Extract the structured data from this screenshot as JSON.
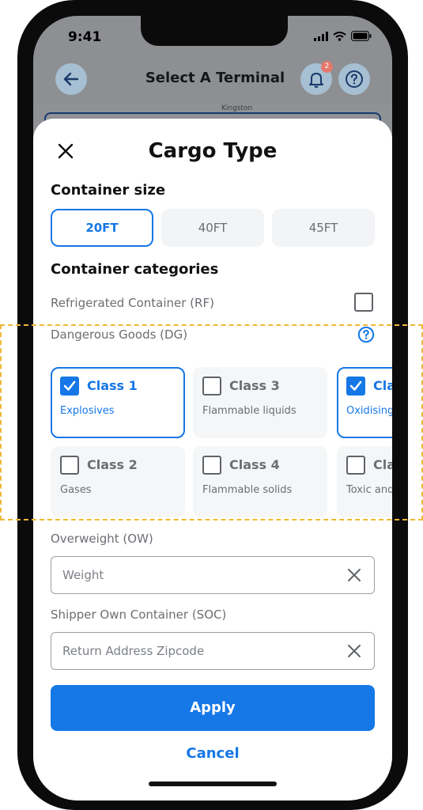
{
  "status_bar": {
    "time": "9:41"
  },
  "header": {
    "title": "Select A Terminal",
    "back_icon": "arrow-left-icon",
    "notification_icon": "bell-icon",
    "notification_count": "2",
    "help_icon": "question-circle-icon"
  },
  "map": {
    "label": "Kingston"
  },
  "sheet": {
    "title": "Cargo Type",
    "close_icon": "close-icon",
    "container_size": {
      "title": "Container size",
      "options": [
        "20FT",
        "40FT",
        "45FT"
      ],
      "selected": "20FT"
    },
    "categories": {
      "title": "Container categories",
      "refrigerated": {
        "label": "Refrigerated Container (RF)",
        "checked": false
      },
      "dangerous_goods": {
        "label": "Dangerous Goods (DG)",
        "help_icon": "question-circle-icon",
        "classes": [
          {
            "name": "Class 1",
            "desc": "Explosives",
            "checked": true
          },
          {
            "name": "Class 3",
            "desc": "Flammable liquids",
            "checked": false
          },
          {
            "name": "Cla",
            "desc": "Oxidising & organic",
            "checked": true
          },
          {
            "name": "Class 2",
            "desc": "Gases",
            "checked": false
          },
          {
            "name": "Class 4",
            "desc": "Flammable solids",
            "checked": false
          },
          {
            "name": "Cla",
            "desc": "Toxic and substanc",
            "checked": false
          }
        ]
      }
    },
    "overweight": {
      "label": "Overweight (OW)",
      "placeholder": "Weight",
      "clear_icon": "close-icon"
    },
    "soc": {
      "label": "Shipper Own Container (SOC)",
      "placeholder": "Return Address Zipcode",
      "clear_icon": "close-icon"
    },
    "apply_label": "Apply",
    "cancel_label": "Cancel"
  },
  "colors": {
    "accent": "#1677e6",
    "highlight_dash": "#f0b836",
    "badge": "#e5786b"
  }
}
